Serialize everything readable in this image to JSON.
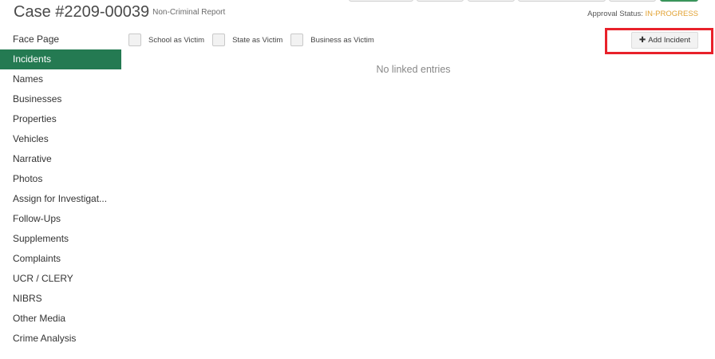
{
  "header": {
    "case_title": "Case #2209-00039",
    "case_subtitle": "Non-Criminal Report",
    "approval_label": "Approval Status: ",
    "approval_status": "IN-PROGRESS",
    "approval_status_color": "#e2a233"
  },
  "sidebar": {
    "active_color": "#247a52",
    "items": [
      {
        "label": "Face Page"
      },
      {
        "label": "Incidents",
        "active": true
      },
      {
        "label": "Names"
      },
      {
        "label": "Businesses"
      },
      {
        "label": "Properties"
      },
      {
        "label": "Vehicles"
      },
      {
        "label": "Narrative"
      },
      {
        "label": "Photos"
      },
      {
        "label": "Assign for Investigat..."
      },
      {
        "label": "Follow-Ups"
      },
      {
        "label": "Supplements"
      },
      {
        "label": "Complaints"
      },
      {
        "label": "UCR / CLERY"
      },
      {
        "label": "NIBRS"
      },
      {
        "label": "Other Media"
      },
      {
        "label": "Crime Analysis"
      }
    ]
  },
  "filters": [
    {
      "label": "School as Victim",
      "checked": false
    },
    {
      "label": "State as Victim",
      "checked": false
    },
    {
      "label": "Business as Victim",
      "checked": false
    }
  ],
  "actions": {
    "add_icon": "plus-icon",
    "add_label": "Add Incident"
  },
  "content": {
    "empty_message": "No linked entries"
  }
}
